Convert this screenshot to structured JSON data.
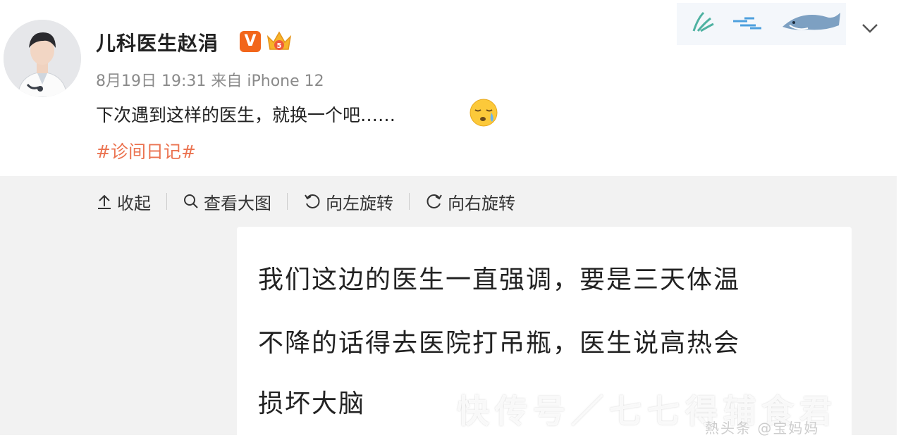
{
  "post": {
    "username": "儿科医生赵涓",
    "verified_badge": "V",
    "meta": "8月19日 19:31 来自 iPhone 12",
    "text": "下次遇到这样的医生，就换一个吧……",
    "hashtag": "#诊间日记#",
    "emoji": "sleepy-face-emoji"
  },
  "toolbar": {
    "collapse": "收起",
    "view_large": "查看大图",
    "rotate_left": "向左旋转",
    "rotate_right": "向右旋转"
  },
  "image_text": {
    "line1": "我们这边的医生一直强调，要是三天体温",
    "line2": "不降的话得去医院打吊瓶，医生说高热会",
    "line3": "损坏大脑"
  },
  "watermark": {
    "main": "快传号／七七得辅食君",
    "sub": "熱头条 @宝妈妈"
  },
  "colors": {
    "hashtag": "#eb7350",
    "badge": "#f2661b",
    "gray_bg": "#f2f2f2"
  }
}
